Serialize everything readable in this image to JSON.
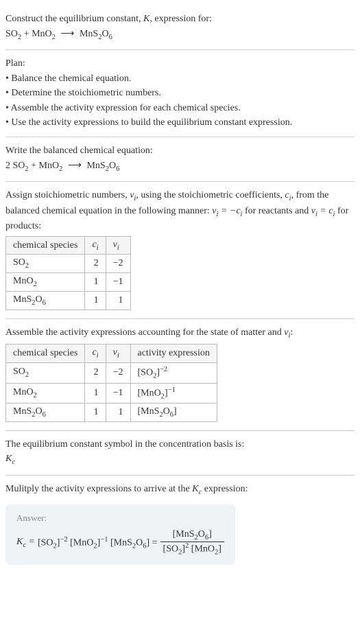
{
  "intro": {
    "line1_pre": "Construct the equilibrium constant, ",
    "line1_sym": "K",
    "line1_post": ", expression for:",
    "eq_lhs1": "SO",
    "eq_lhs1_sub": "2",
    "eq_plus": " + ",
    "eq_lhs2": "MnO",
    "eq_lhs2_sub": "2",
    "eq_arrow": "⟶",
    "eq_rhs": "MnS",
    "eq_rhs_sub1": "2",
    "eq_rhs_mid": "O",
    "eq_rhs_sub2": "6"
  },
  "plan": {
    "title": "Plan:",
    "b1": "• Balance the chemical equation.",
    "b2": "• Determine the stoichiometric numbers.",
    "b3": "• Assemble the activity expression for each chemical species.",
    "b4": "• Use the activity expressions to build the equilibrium constant expression."
  },
  "balanced": {
    "title": "Write the balanced chemical equation:",
    "c1": "2 SO",
    "c1_sub": "2",
    "plus": " + MnO",
    "c2_sub": "2",
    "arrow": "⟶",
    "rhs": "MnS",
    "rhs_sub1": "2",
    "rhs_mid": "O",
    "rhs_sub2": "6"
  },
  "stoich": {
    "title_pre": "Assign stoichiometric numbers, ",
    "title_mid1": ", using the stoichiometric coefficients, ",
    "title_mid2": ", from the balanced chemical equation in the following manner: ",
    "title_mid3": " for reactants and ",
    "title_post": " for products:",
    "h1": "chemical species",
    "r1c1": "SO",
    "r1c1_sub": "2",
    "r1c2": "2",
    "r1c3": "−2",
    "r2c1": "MnO",
    "r2c1_sub": "2",
    "r2c2": "1",
    "r2c3": "−1",
    "r3c1": "MnS",
    "r3c1_sub1": "2",
    "r3c1_mid": "O",
    "r3c1_sub2": "6",
    "r3c2": "1",
    "r3c3": "1"
  },
  "activity": {
    "title_pre": "Assemble the activity expressions accounting for the state of matter and ",
    "title_post": ":",
    "h1": "chemical species",
    "h4": "activity expression",
    "r1_exp": "−2",
    "r2_exp": "−1"
  },
  "kc_symbol": {
    "title": "The equilibrium constant symbol in the concentration basis is:",
    "sym": "K",
    "sub": "c"
  },
  "multiply": {
    "title_pre": "Mulitply the activity expressions to arrive at the ",
    "title_post": " expression:"
  },
  "answer": {
    "label": "Answer:"
  }
}
